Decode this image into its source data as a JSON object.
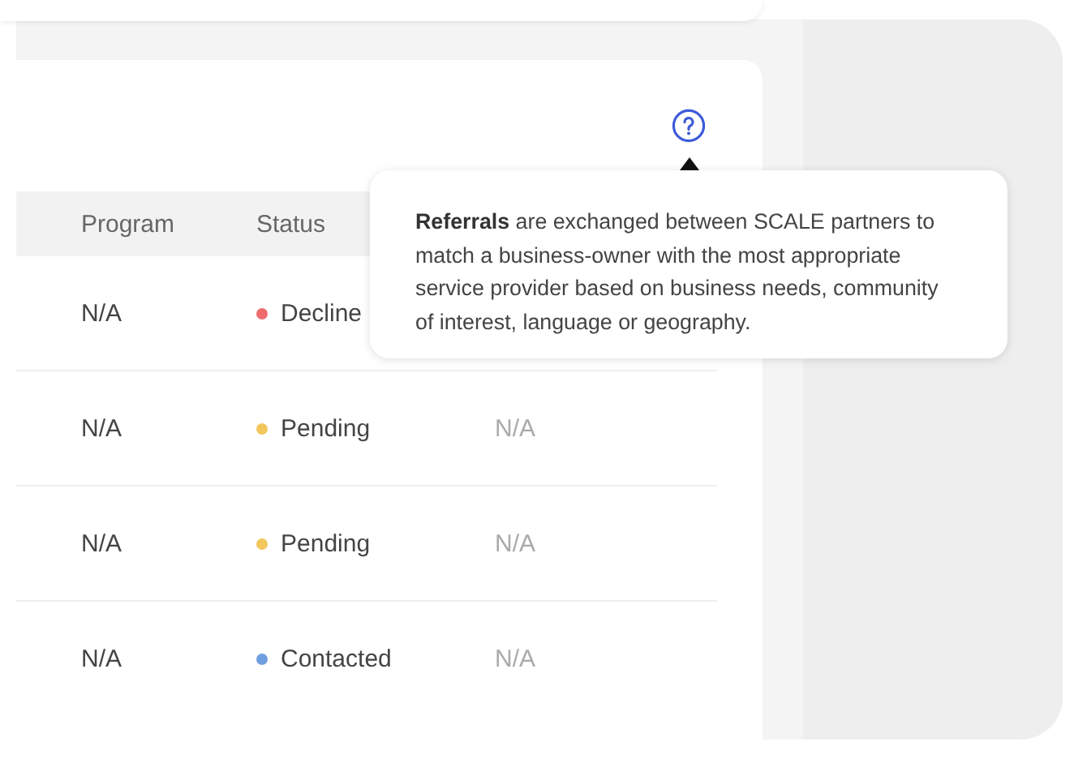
{
  "table": {
    "columns": [
      "Program",
      "Status"
    ],
    "rows": [
      {
        "program": "N/A",
        "status": "Decline",
        "color": "#ee6b6e"
      },
      {
        "program": "N/A",
        "status": "Pending",
        "color": "#f2c75c",
        "column_3": "N/A"
      },
      {
        "program": "N/A",
        "status": "Pending",
        "color": "#f2c75c",
        "column_3": "N/A"
      },
      {
        "program": "N/A",
        "status": "Contacted",
        "color": "#6f9fe0",
        "column_3": "N/A"
      }
    ]
  },
  "tooltip": {
    "text": "**Referrals** are exchanged between SCALE partners to match a business-owner with the most appropriate service provider based on business needs, community of interest, language or geography."
  }
}
